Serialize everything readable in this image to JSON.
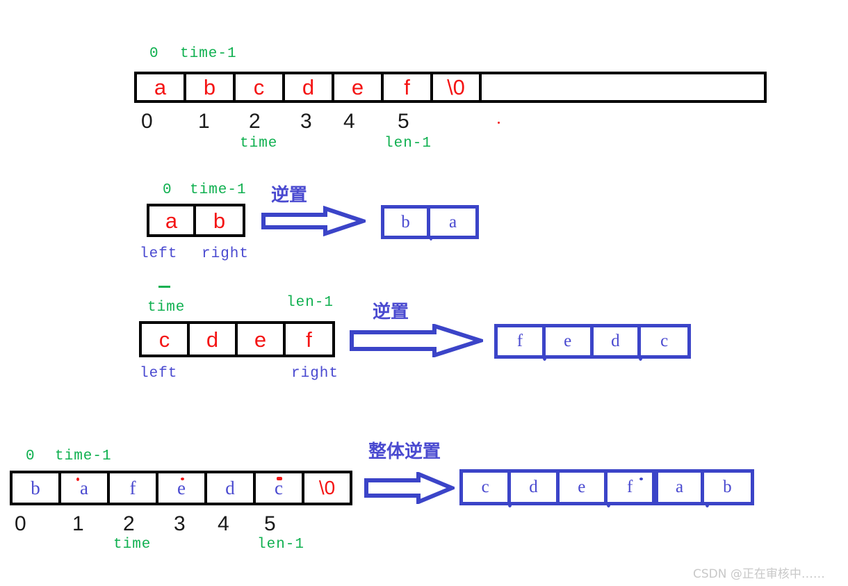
{
  "diagram": {
    "watermark": "CSDN @正在审核中……"
  },
  "row1": {
    "top_labels": {
      "zero": "0",
      "time_minus_1": "time-1"
    },
    "cells": [
      "a",
      "b",
      "c",
      "d",
      "e",
      "f",
      "\\0"
    ],
    "indices": [
      "0",
      "1",
      "2",
      "3",
      "4",
      "5"
    ],
    "under_labels": {
      "time": "time",
      "len_minus_1": "len-1"
    }
  },
  "row2": {
    "top_labels": {
      "zero": "0",
      "time_minus_1": "time-1"
    },
    "source_cells": [
      "a",
      "b"
    ],
    "bottom_labels": {
      "left": "left",
      "right": "right"
    },
    "operation": "逆置",
    "result_cells": [
      "b",
      "a"
    ]
  },
  "row3": {
    "top_labels": {
      "time": "time",
      "len_minus_1": "len-1"
    },
    "source_cells": [
      "c",
      "d",
      "e",
      "f"
    ],
    "bottom_labels": {
      "left": "left",
      "right": "right"
    },
    "operation": "逆置",
    "result_cells": [
      "f",
      "e",
      "d",
      "c"
    ]
  },
  "row4": {
    "top_labels": {
      "zero": "0",
      "time_minus_1": "time-1"
    },
    "source_cells": [
      "b",
      "a",
      "f",
      "e",
      "d",
      "c",
      "\\0"
    ],
    "indices": [
      "0",
      "1",
      "2",
      "3",
      "4",
      "5"
    ],
    "under_labels": {
      "time": "time",
      "len_minus_1": "len-1"
    },
    "operation": "整体逆置",
    "result_cells": [
      "c",
      "d",
      "e",
      "f",
      "a",
      "b"
    ]
  },
  "colors": {
    "green": "#10b050",
    "blue": "#3b44c8",
    "red": "#f41414",
    "black": "#000000"
  }
}
